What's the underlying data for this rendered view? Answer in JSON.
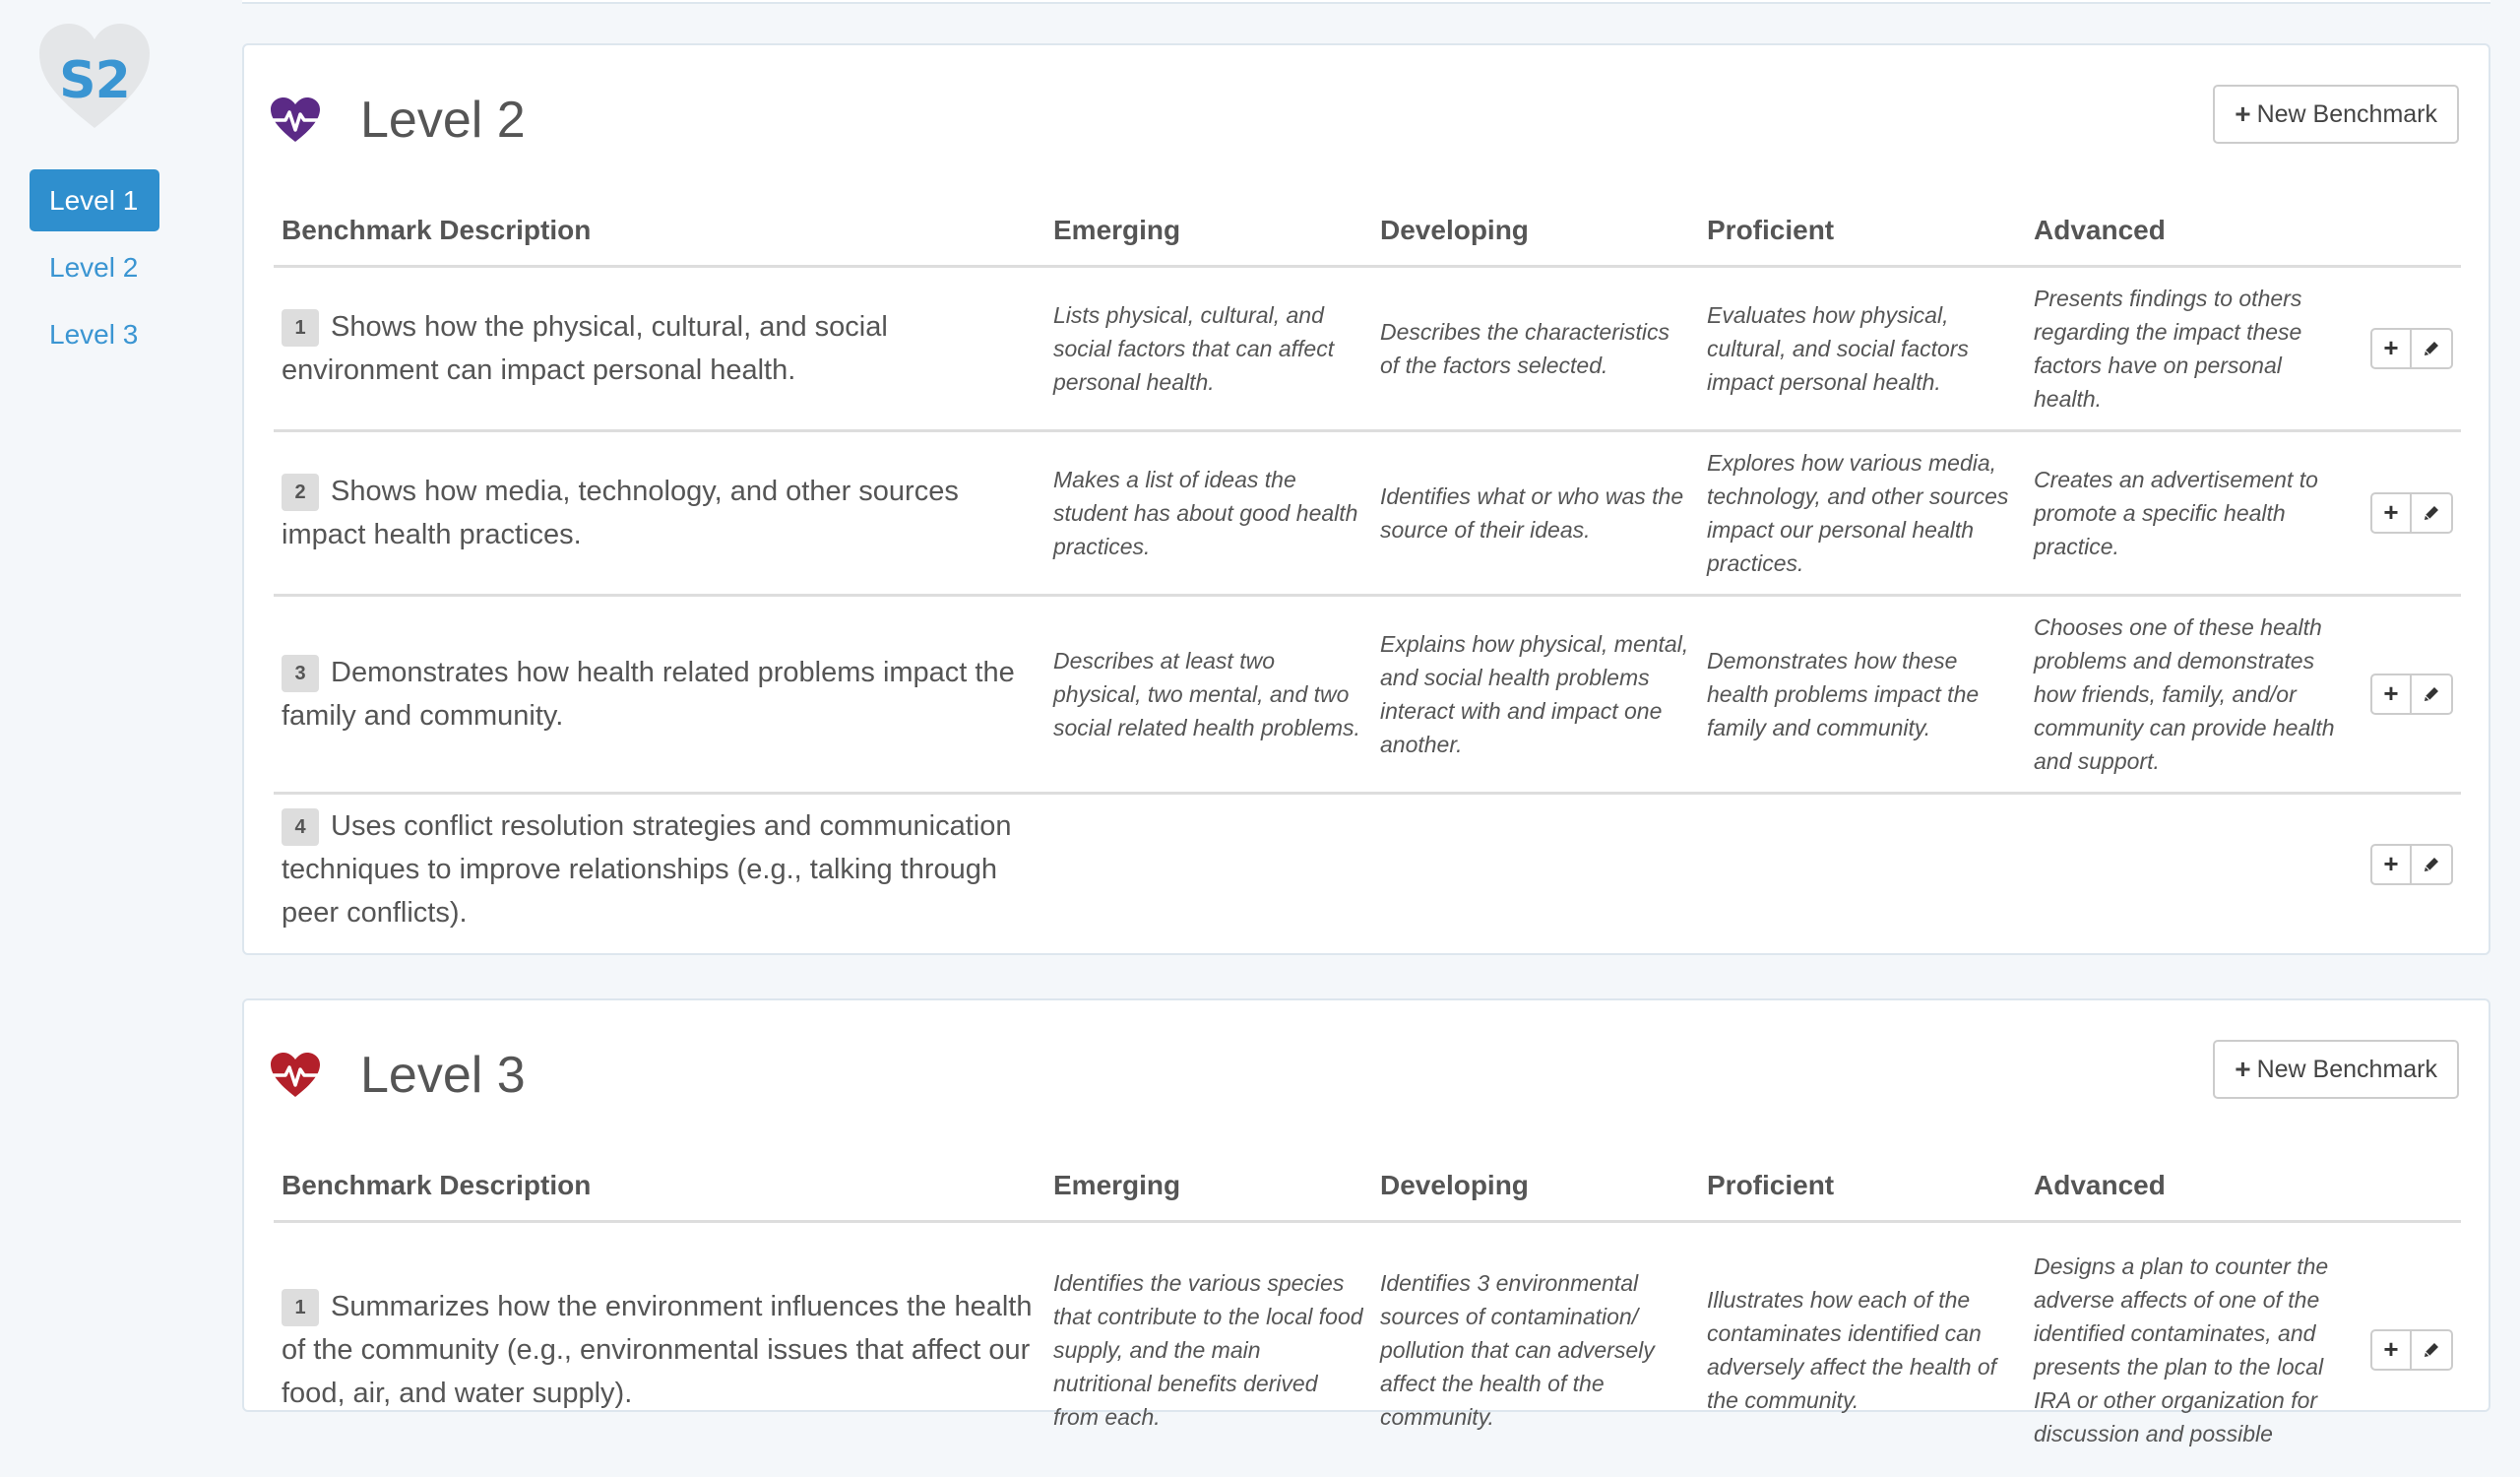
{
  "app": {
    "logo_text": "S2"
  },
  "sidebar": {
    "items": [
      {
        "label": "Level 1",
        "active": true
      },
      {
        "label": "Level 2",
        "active": false
      },
      {
        "label": "Level 3",
        "active": false
      }
    ]
  },
  "columns": {
    "description": "Benchmark Description",
    "emerging": "Emerging",
    "developing": "Developing",
    "proficient": "Proficient",
    "advanced": "Advanced"
  },
  "new_benchmark_label": "New Benchmark",
  "colors": {
    "accent": "#2f8fce",
    "level2_heart": "#5b2a86",
    "level3_heart": "#b3202a"
  },
  "levels": [
    {
      "title": "Level 2",
      "icon": "heartbeat-icon",
      "benchmarks": [
        {
          "number": "1",
          "description": "Shows how the physical, cultural, and social environment can impact personal health.",
          "emerging": "Lists physical, cultural, and social factors that can affect personal health.",
          "developing": "Describes the characteristics of the factors selected.",
          "proficient": "Evaluates how physical, cultural, and social factors impact personal health.",
          "advanced": "Presents findings to others regarding the impact these factors have on personal health."
        },
        {
          "number": "2",
          "description": "Shows how media, technology, and other sources impact health practices.",
          "emerging": "Makes a list of ideas the student has about good health practices.",
          "developing": "Identifies what or who was the source of their ideas.",
          "proficient": "Explores how various media, technology, and other sources impact our personal health practices.",
          "advanced": "Creates an advertisement to promote a specific health practice."
        },
        {
          "number": "3",
          "description": "Demonstrates how health related problems impact the family and community.",
          "emerging": "Describes at least two physical, two mental, and two social related health problems.",
          "developing": "Explains how physical, mental, and social health problems interact with and impact one another.",
          "proficient": "Demonstrates how these health problems impact the family and community.",
          "advanced": "Chooses one of these health problems and demonstrates how friends, family, and/or community can provide health and support."
        },
        {
          "number": "4",
          "description": "Uses conflict resolution strategies and communication techniques to improve relationships (e.g., talking through peer conflicts).",
          "emerging": "",
          "developing": "",
          "proficient": "",
          "advanced": ""
        }
      ]
    },
    {
      "title": "Level 3",
      "icon": "heartbeat-icon",
      "benchmarks": [
        {
          "number": "1",
          "description": "Summarizes how the environment influences the health of the community (e.g., environmental issues that affect our food, air, and water supply).",
          "emerging": "Identifies the various species that contribute to the local food supply, and the main nutritional benefits derived from each.",
          "developing": "Identifies 3 environmental sources of contamination/ pollution that can adversely affect the health of the community.",
          "proficient": "Illustrates how each of the contaminates identified can adversely affect the health of the community.",
          "advanced": "Designs a plan to counter the adverse affects of one of the identified contaminates, and presents the plan to the local IRA or other organization for discussion and possible"
        }
      ]
    }
  ]
}
